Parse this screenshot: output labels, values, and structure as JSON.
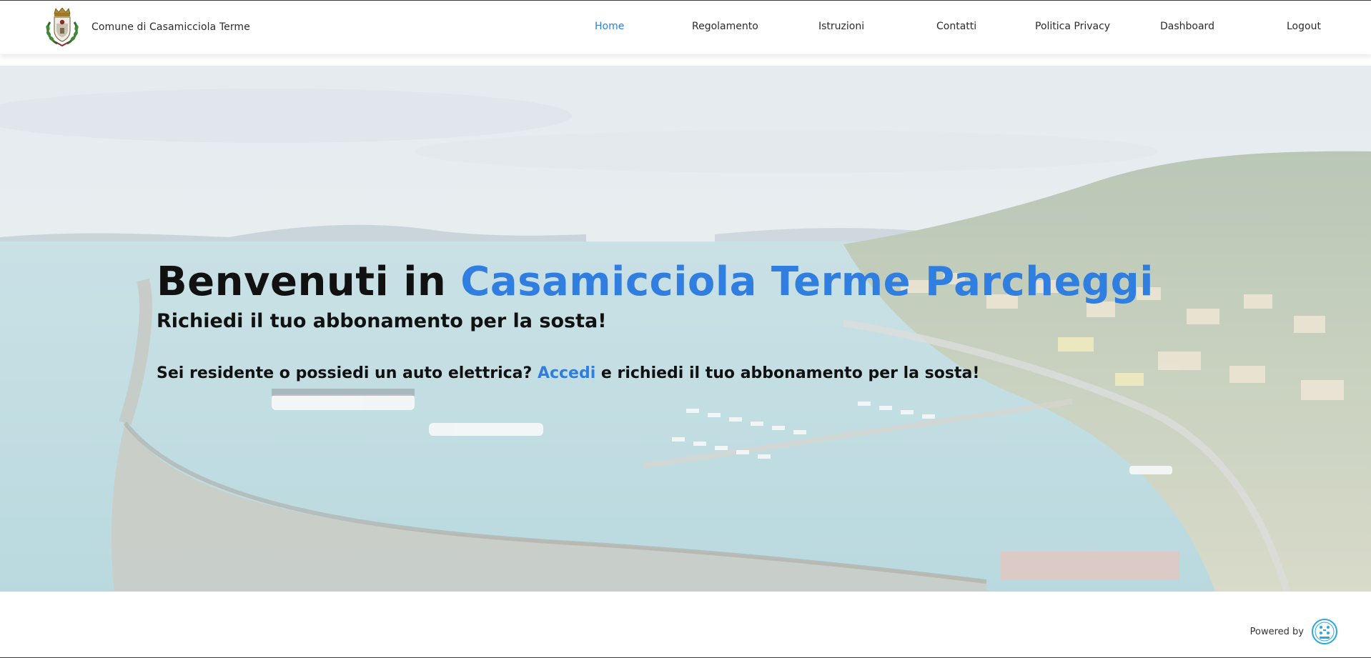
{
  "header": {
    "brand_name": "Comune di Casamicciola Terme",
    "crest_icon": "municipal-crest-icon",
    "nav": [
      {
        "label": "Home",
        "active": true
      },
      {
        "label": "Regolamento",
        "active": false
      },
      {
        "label": "Istruzioni",
        "active": false
      },
      {
        "label": "Contatti",
        "active": false
      },
      {
        "label": "Politica Privacy",
        "active": false
      },
      {
        "label": "Dashboard",
        "active": false
      },
      {
        "label": "Logout",
        "active": false
      }
    ]
  },
  "hero": {
    "title_prefix": "Benvenuti in ",
    "title_accent": "Casamicciola Terme Parcheggi",
    "subtitle": "Richiedi il tuo abbonamento per la sosta!",
    "cta_before": "Sei residente o possiedi un auto elettrica? ",
    "cta_link": "Accedi",
    "cta_after": " e richiedi il tuo abbonamento per la sosta!",
    "background_image": "harbor-aerial-photo"
  },
  "footer": {
    "powered_label": "Powered by",
    "powered_logo": "city-logo-icon"
  },
  "colors": {
    "accent": "#2f7ee0",
    "text": "#111111",
    "nav_text": "#2b2b2b"
  }
}
